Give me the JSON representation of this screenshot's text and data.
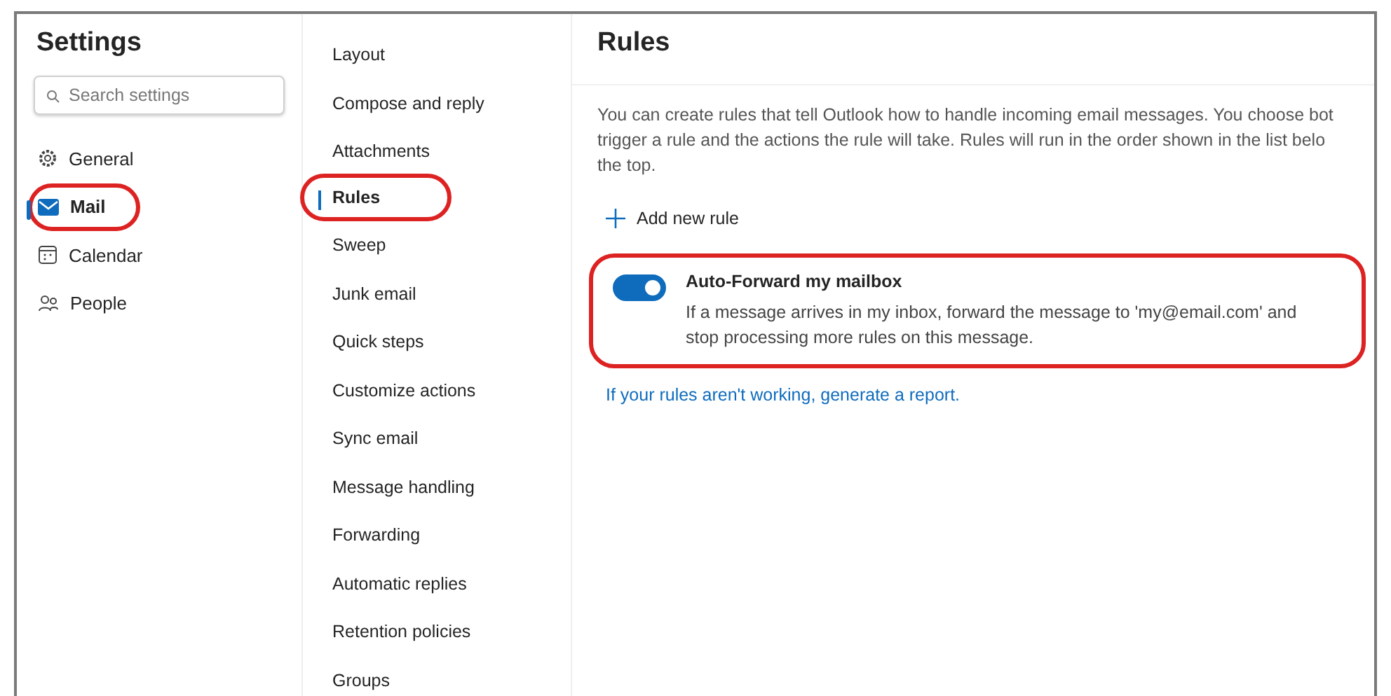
{
  "sidebar": {
    "title": "Settings",
    "search": {
      "placeholder": "Search settings"
    },
    "items": [
      {
        "label": "General",
        "selected": false,
        "highlighted": false
      },
      {
        "label": "Mail",
        "selected": true,
        "highlighted": true
      },
      {
        "label": "Calendar",
        "selected": false,
        "highlighted": false
      },
      {
        "label": "People",
        "selected": false,
        "highlighted": false
      }
    ]
  },
  "subnav": {
    "items": [
      {
        "label": "Layout",
        "selected": false,
        "highlighted": false
      },
      {
        "label": "Compose and reply",
        "selected": false,
        "highlighted": false
      },
      {
        "label": "Attachments",
        "selected": false,
        "highlighted": false
      },
      {
        "label": "Rules",
        "selected": true,
        "highlighted": true
      },
      {
        "label": "Sweep",
        "selected": false,
        "highlighted": false
      },
      {
        "label": "Junk email",
        "selected": false,
        "highlighted": false
      },
      {
        "label": "Quick steps",
        "selected": false,
        "highlighted": false
      },
      {
        "label": "Customize actions",
        "selected": false,
        "highlighted": false
      },
      {
        "label": "Sync email",
        "selected": false,
        "highlighted": false
      },
      {
        "label": "Message handling",
        "selected": false,
        "highlighted": false
      },
      {
        "label": "Forwarding",
        "selected": false,
        "highlighted": false
      },
      {
        "label": "Automatic replies",
        "selected": false,
        "highlighted": false
      },
      {
        "label": "Retention policies",
        "selected": false,
        "highlighted": false
      },
      {
        "label": "Groups",
        "selected": false,
        "highlighted": false
      }
    ]
  },
  "main": {
    "title": "Rules",
    "description_lines": [
      "You can create rules that tell Outlook how to handle incoming email messages. You choose bot",
      "trigger a rule and the actions the rule will take. Rules will run in the order shown in the list belo",
      "the top."
    ],
    "add_button": "Add new rule",
    "rules": [
      {
        "name": "Auto-Forward my mailbox",
        "on": true,
        "highlighted": true,
        "description_lines": [
          "If a message arrives in my inbox, forward the message to 'my@email.com' and",
          "stop processing more rules on this message."
        ]
      }
    ],
    "report_link": "If your rules aren't working, generate a report."
  }
}
